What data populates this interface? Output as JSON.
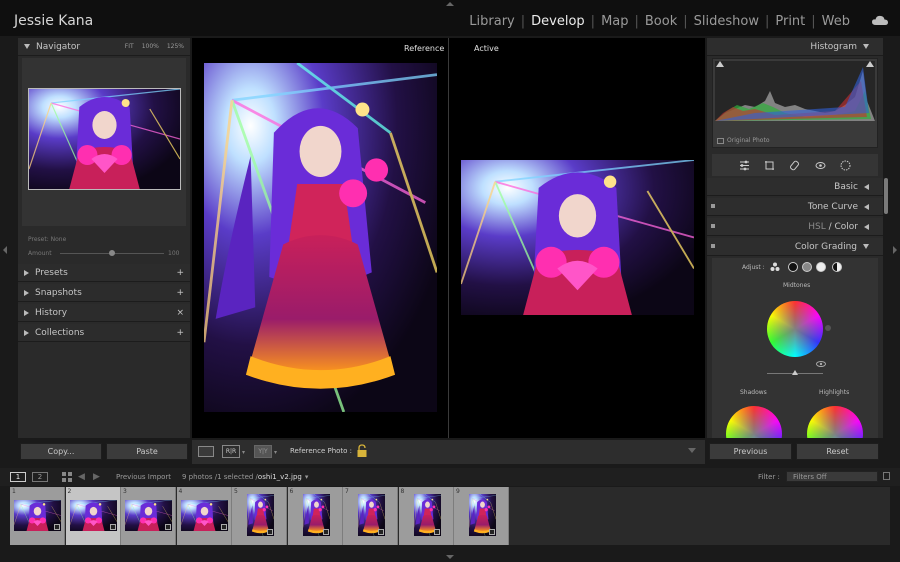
{
  "user": {
    "name": "Jessie Kana"
  },
  "modules": [
    {
      "label": "Library",
      "active": false
    },
    {
      "label": "Develop",
      "active": true
    },
    {
      "label": "Map",
      "active": false
    },
    {
      "label": "Book",
      "active": false
    },
    {
      "label": "Slideshow",
      "active": false
    },
    {
      "label": "Print",
      "active": false
    },
    {
      "label": "Web",
      "active": false
    }
  ],
  "navigator": {
    "title": "Navigator",
    "zoom_fit": "FIT",
    "zoom_100": "100%",
    "zoom_125": "125%"
  },
  "preset": {
    "label": "Preset: None",
    "amount_label": "Amount",
    "amount_value": "100",
    "amount_fraction": 0.5
  },
  "left_panels": {
    "presets": "Presets",
    "snapshots": "Snapshots",
    "history": "History",
    "collections": "Collections"
  },
  "left_buttons": {
    "copy": "Copy...",
    "paste": "Paste"
  },
  "view": {
    "reference_label": "Reference",
    "active_label": "Active"
  },
  "toolbar": {
    "view_rr": "R|R",
    "view_yy": "Y|Y",
    "reference_photo": "Reference Photo :"
  },
  "right_panels": {
    "histogram": "Histogram",
    "original_photo": "Original Photo",
    "basic": "Basic",
    "tone_curve": "Tone Curve",
    "hsl": "HSL",
    "color": "Color",
    "color_grading": "Color Grading",
    "adjust": "Adjust :",
    "midtones": "Midtones",
    "shadows": "Shadows",
    "highlights": "Highlights"
  },
  "right_buttons": {
    "previous": "Previous",
    "reset": "Reset"
  },
  "filmstrip_bar": {
    "tab1": "1",
    "tab2": "2",
    "source": "Previous Import",
    "count": "9 photos /1 selected /",
    "filename": "oshi1_v2.jpg",
    "filter_label": "Filter :",
    "filter_value": "Filters Off"
  },
  "filmstrip": [
    {
      "num": "1",
      "orientation": "landscape",
      "selected": false
    },
    {
      "num": "2",
      "orientation": "landscape",
      "selected": true
    },
    {
      "num": "3",
      "orientation": "landscape",
      "selected": false
    },
    {
      "num": "4",
      "orientation": "landscape",
      "selected": false
    },
    {
      "num": "5",
      "orientation": "portrait",
      "selected": false
    },
    {
      "num": "6",
      "orientation": "portrait",
      "selected": false
    },
    {
      "num": "7",
      "orientation": "portrait",
      "selected": false
    },
    {
      "num": "8",
      "orientation": "portrait",
      "selected": false
    },
    {
      "num": "9",
      "orientation": "portrait",
      "selected": false
    }
  ],
  "colors": {
    "accent_panel": "#2a2a2a",
    "photo_magenta": "#ff2fb0",
    "photo_purple": "#7a3cff"
  }
}
